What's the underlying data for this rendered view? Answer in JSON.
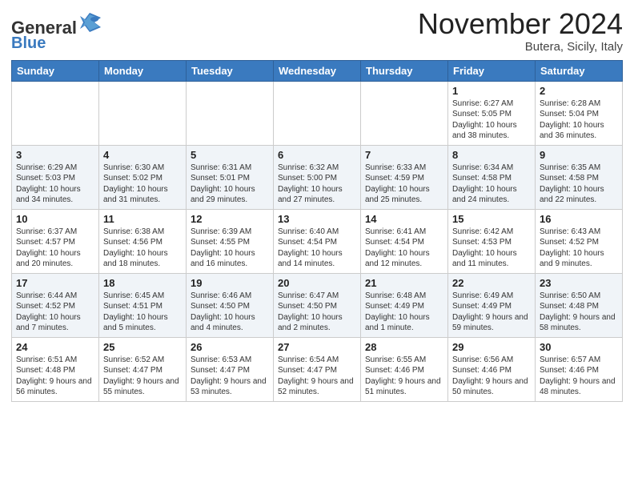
{
  "header": {
    "logo_general": "General",
    "logo_blue": "Blue",
    "month_title": "November 2024",
    "location": "Butera, Sicily, Italy"
  },
  "weekdays": [
    "Sunday",
    "Monday",
    "Tuesday",
    "Wednesday",
    "Thursday",
    "Friday",
    "Saturday"
  ],
  "weeks": [
    [
      {
        "day": "",
        "info": ""
      },
      {
        "day": "",
        "info": ""
      },
      {
        "day": "",
        "info": ""
      },
      {
        "day": "",
        "info": ""
      },
      {
        "day": "",
        "info": ""
      },
      {
        "day": "1",
        "info": "Sunrise: 6:27 AM\nSunset: 5:05 PM\nDaylight: 10 hours and 38 minutes."
      },
      {
        "day": "2",
        "info": "Sunrise: 6:28 AM\nSunset: 5:04 PM\nDaylight: 10 hours and 36 minutes."
      }
    ],
    [
      {
        "day": "3",
        "info": "Sunrise: 6:29 AM\nSunset: 5:03 PM\nDaylight: 10 hours and 34 minutes."
      },
      {
        "day": "4",
        "info": "Sunrise: 6:30 AM\nSunset: 5:02 PM\nDaylight: 10 hours and 31 minutes."
      },
      {
        "day": "5",
        "info": "Sunrise: 6:31 AM\nSunset: 5:01 PM\nDaylight: 10 hours and 29 minutes."
      },
      {
        "day": "6",
        "info": "Sunrise: 6:32 AM\nSunset: 5:00 PM\nDaylight: 10 hours and 27 minutes."
      },
      {
        "day": "7",
        "info": "Sunrise: 6:33 AM\nSunset: 4:59 PM\nDaylight: 10 hours and 25 minutes."
      },
      {
        "day": "8",
        "info": "Sunrise: 6:34 AM\nSunset: 4:58 PM\nDaylight: 10 hours and 24 minutes."
      },
      {
        "day": "9",
        "info": "Sunrise: 6:35 AM\nSunset: 4:58 PM\nDaylight: 10 hours and 22 minutes."
      }
    ],
    [
      {
        "day": "10",
        "info": "Sunrise: 6:37 AM\nSunset: 4:57 PM\nDaylight: 10 hours and 20 minutes."
      },
      {
        "day": "11",
        "info": "Sunrise: 6:38 AM\nSunset: 4:56 PM\nDaylight: 10 hours and 18 minutes."
      },
      {
        "day": "12",
        "info": "Sunrise: 6:39 AM\nSunset: 4:55 PM\nDaylight: 10 hours and 16 minutes."
      },
      {
        "day": "13",
        "info": "Sunrise: 6:40 AM\nSunset: 4:54 PM\nDaylight: 10 hours and 14 minutes."
      },
      {
        "day": "14",
        "info": "Sunrise: 6:41 AM\nSunset: 4:54 PM\nDaylight: 10 hours and 12 minutes."
      },
      {
        "day": "15",
        "info": "Sunrise: 6:42 AM\nSunset: 4:53 PM\nDaylight: 10 hours and 11 minutes."
      },
      {
        "day": "16",
        "info": "Sunrise: 6:43 AM\nSunset: 4:52 PM\nDaylight: 10 hours and 9 minutes."
      }
    ],
    [
      {
        "day": "17",
        "info": "Sunrise: 6:44 AM\nSunset: 4:52 PM\nDaylight: 10 hours and 7 minutes."
      },
      {
        "day": "18",
        "info": "Sunrise: 6:45 AM\nSunset: 4:51 PM\nDaylight: 10 hours and 5 minutes."
      },
      {
        "day": "19",
        "info": "Sunrise: 6:46 AM\nSunset: 4:50 PM\nDaylight: 10 hours and 4 minutes."
      },
      {
        "day": "20",
        "info": "Sunrise: 6:47 AM\nSunset: 4:50 PM\nDaylight: 10 hours and 2 minutes."
      },
      {
        "day": "21",
        "info": "Sunrise: 6:48 AM\nSunset: 4:49 PM\nDaylight: 10 hours and 1 minute."
      },
      {
        "day": "22",
        "info": "Sunrise: 6:49 AM\nSunset: 4:49 PM\nDaylight: 9 hours and 59 minutes."
      },
      {
        "day": "23",
        "info": "Sunrise: 6:50 AM\nSunset: 4:48 PM\nDaylight: 9 hours and 58 minutes."
      }
    ],
    [
      {
        "day": "24",
        "info": "Sunrise: 6:51 AM\nSunset: 4:48 PM\nDaylight: 9 hours and 56 minutes."
      },
      {
        "day": "25",
        "info": "Sunrise: 6:52 AM\nSunset: 4:47 PM\nDaylight: 9 hours and 55 minutes."
      },
      {
        "day": "26",
        "info": "Sunrise: 6:53 AM\nSunset: 4:47 PM\nDaylight: 9 hours and 53 minutes."
      },
      {
        "day": "27",
        "info": "Sunrise: 6:54 AM\nSunset: 4:47 PM\nDaylight: 9 hours and 52 minutes."
      },
      {
        "day": "28",
        "info": "Sunrise: 6:55 AM\nSunset: 4:46 PM\nDaylight: 9 hours and 51 minutes."
      },
      {
        "day": "29",
        "info": "Sunrise: 6:56 AM\nSunset: 4:46 PM\nDaylight: 9 hours and 50 minutes."
      },
      {
        "day": "30",
        "info": "Sunrise: 6:57 AM\nSunset: 4:46 PM\nDaylight: 9 hours and 48 minutes."
      }
    ]
  ]
}
